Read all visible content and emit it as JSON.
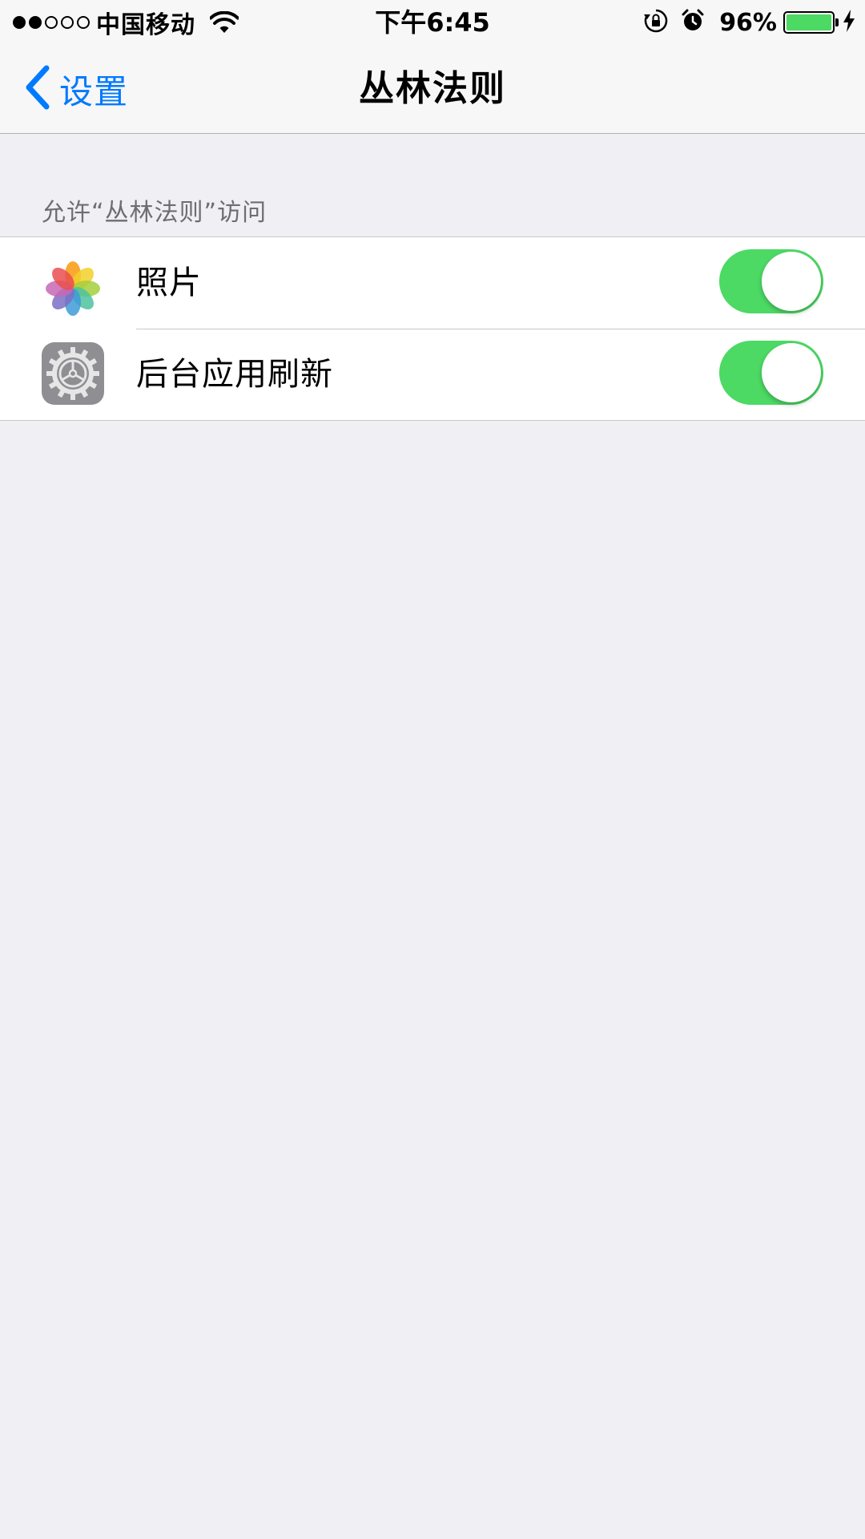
{
  "status_bar": {
    "carrier": "中国移动",
    "time": "下午6:45",
    "battery_percent": "96%",
    "signal_dots": [
      1,
      1,
      0,
      0,
      0
    ],
    "icons": [
      "wifi-icon",
      "rotation-lock-icon",
      "alarm-icon",
      "battery-icon",
      "charging-icon"
    ]
  },
  "nav": {
    "back_label": "设置",
    "title": "丛林法则"
  },
  "section": {
    "header": "允许“丛林法则”访问"
  },
  "rows": [
    {
      "label": "照片",
      "icon": "photos-app-icon",
      "enabled": true
    },
    {
      "label": "后台应用刷新",
      "icon": "settings-gear-icon",
      "enabled": true
    }
  ],
  "colors": {
    "accent": "#007aff",
    "toggle_on": "#4cd964",
    "background": "#efeff4",
    "section_header": "#6d6d72"
  }
}
